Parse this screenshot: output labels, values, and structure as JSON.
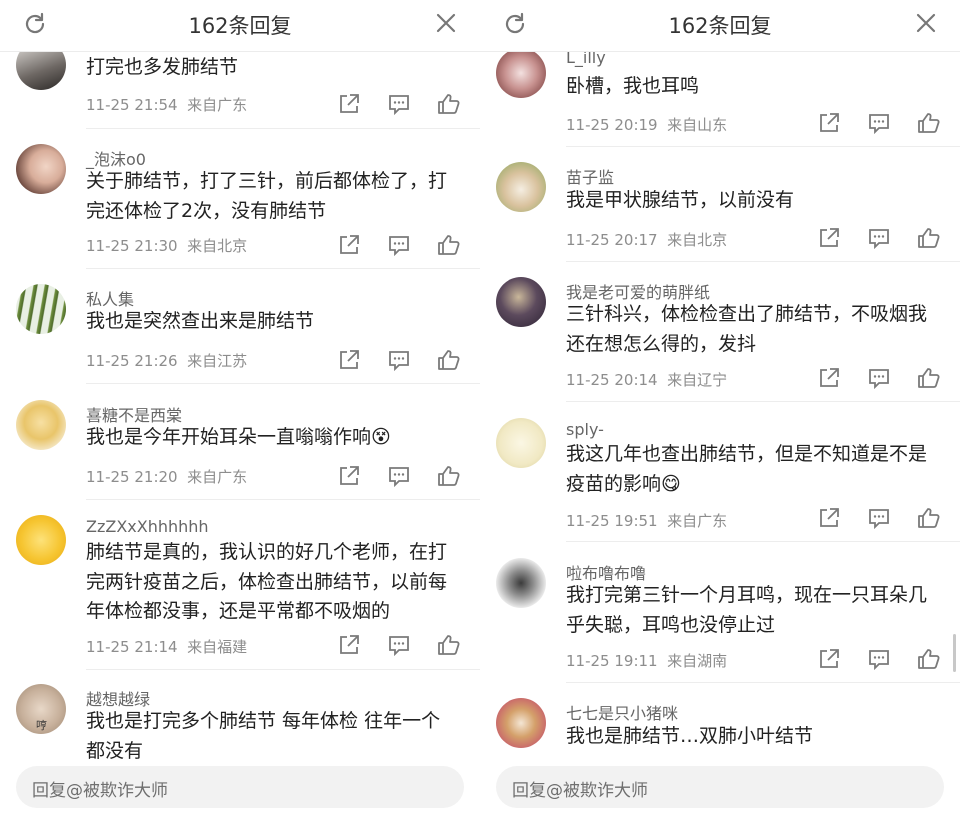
{
  "header_title": "162条回复",
  "reply_placeholder": "回复@被欺诈大师",
  "left_comments": [
    {
      "author": "",
      "text": "打完也多发肺结节",
      "time": "11-25 21:54",
      "location": "来自广东"
    },
    {
      "author": "_泡沫o0",
      "text": "关于肺结节，打了三针，前后都体检了，打完还体检了2次，没有肺结节",
      "time": "11-25 21:30",
      "location": "来自北京"
    },
    {
      "author": "私人集",
      "text": "我也是突然查出来是肺结节",
      "time": "11-25 21:26",
      "location": "来自江苏"
    },
    {
      "author": "喜糖不是西棠",
      "text": "我也是今年开始耳朵一直嗡嗡作响😵",
      "time": "11-25 21:20",
      "location": "来自广东"
    },
    {
      "author": "ZzZXxXhhhhhh",
      "text": "肺结节是真的，我认识的好几个老师，在打完两针疫苗之后，体检查出肺结节，以前每年体检都没事，还是平常都不吸烟的",
      "time": "11-25 21:14",
      "location": "来自福建"
    },
    {
      "author": "越想越绿",
      "text": "我也是打完多个肺结节 每年体检 往年一个都没有",
      "time": "",
      "location": "",
      "avatar_caption": "哼"
    }
  ],
  "right_comments": [
    {
      "author": "L_illy",
      "text": "卧槽，我也耳鸣",
      "time": "11-25 20:19",
      "location": "来自山东"
    },
    {
      "author": "苗子监",
      "text": "我是甲状腺结节，以前没有",
      "time": "11-25 20:17",
      "location": "来自北京"
    },
    {
      "author": "我是老可爱的萌胖纸",
      "text": "三针科兴，体检检查出了肺结节，不吸烟我还在想怎么得的，发抖",
      "time": "11-25 20:14",
      "location": "来自辽宁"
    },
    {
      "author": "sply-",
      "text": "我这几年也查出肺结节，但是不知道是不是疫苗的影响😋",
      "time": "11-25 19:51",
      "location": "来自广东"
    },
    {
      "author": "啦布噜布噜",
      "text": "我打完第三针一个月耳鸣，现在一只耳朵几乎失聪，耳鸣也没停止过",
      "time": "11-25 19:11",
      "location": "来自湖南"
    },
    {
      "author": "七七是只小猪咪",
      "text": "我也是肺结节…双肺小叶结节",
      "time": "",
      "location": ""
    }
  ],
  "colors": {
    "accent_text": "#222222",
    "meta_text": "#8d8d8d",
    "icon": "#7a7a7a",
    "reply_bg": "#f2f2f2"
  }
}
